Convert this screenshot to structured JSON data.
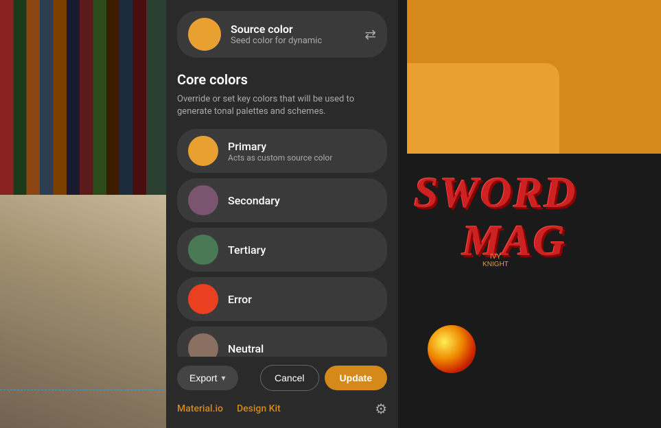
{
  "background": {
    "sword_text": "SWORD",
    "mag_text": "MAG",
    "ivy_knight_line1": "IVY",
    "ivy_knight_line2": "KNIGHT"
  },
  "panel": {
    "source_color": {
      "title": "Source color",
      "subtitle": "Seed color for dynamic",
      "color": "#e8a030"
    },
    "core_colors": {
      "section_title": "Core colors",
      "section_desc": "Override or set key colors that will be used to generate tonal palettes and schemes.",
      "items": [
        {
          "label": "Primary",
          "sublabel": "Acts as custom source color",
          "color": "#e8a030"
        },
        {
          "label": "Secondary",
          "sublabel": "",
          "color": "#7b5470"
        },
        {
          "label": "Tertiary",
          "sublabel": "",
          "color": "#4a7a55"
        },
        {
          "label": "Error",
          "sublabel": "",
          "color": "#e84020"
        },
        {
          "label": "Neutral",
          "sublabel": "",
          "color": "#8a7060"
        }
      ]
    },
    "footer": {
      "export_label": "Export",
      "cancel_label": "Cancel",
      "update_label": "Update",
      "link_material": "Material.io",
      "link_design_kit": "Design Kit"
    }
  }
}
